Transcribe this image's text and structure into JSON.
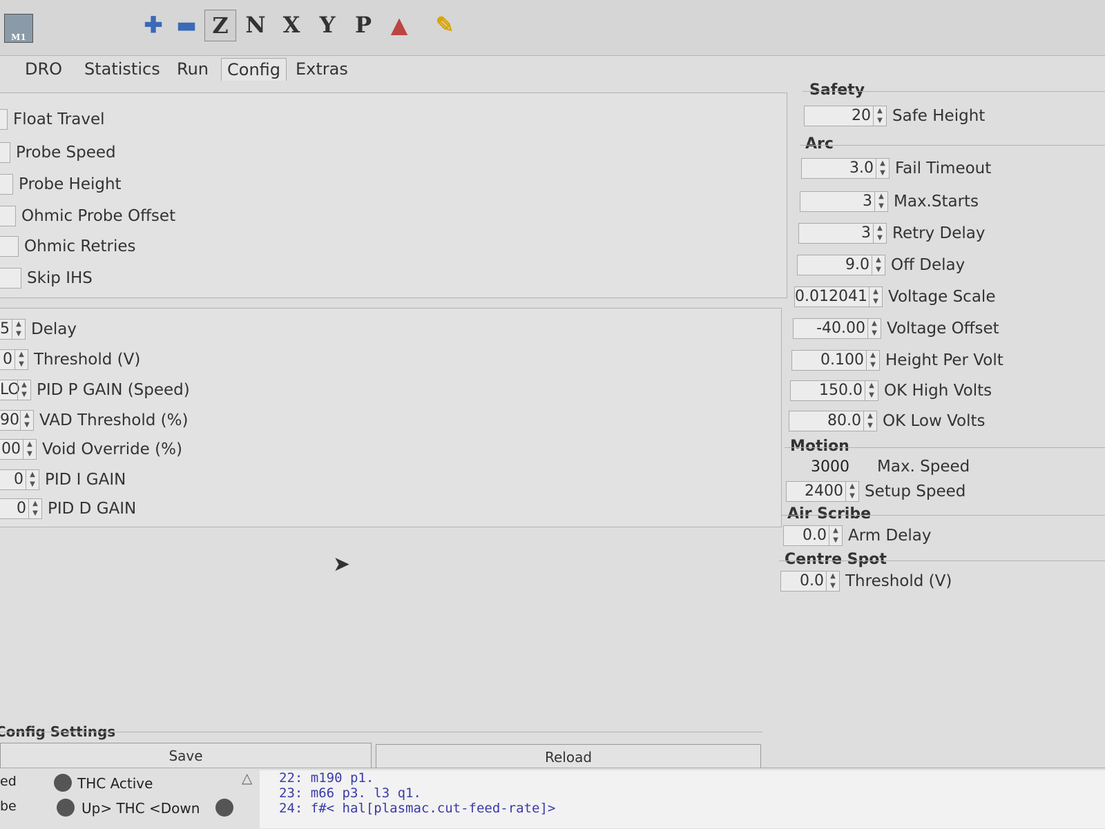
{
  "toolbar": {
    "buttons": [
      {
        "icon": "machine-icon"
      },
      {
        "icon": "plus-icon"
      },
      {
        "icon": "minus-icon"
      },
      {
        "label": "Z"
      },
      {
        "label": "N"
      },
      {
        "label": "X"
      },
      {
        "label": "Y"
      },
      {
        "label": "P"
      },
      {
        "icon": "torch-icon"
      },
      {
        "icon": "brush-icon"
      }
    ],
    "machine_text": "M1"
  },
  "tabs": [
    "DRO",
    "Statistics",
    "Run",
    "Config",
    "Extras"
  ],
  "active_tab": "Config",
  "left_panel_1": {
    "rows": [
      {
        "value": "",
        "label": "Float Travel"
      },
      {
        "value": "",
        "label": "Probe Speed"
      },
      {
        "value": "",
        "label": "Probe Height"
      },
      {
        "value": "",
        "label": "Ohmic Probe Offset"
      },
      {
        "value": "",
        "label": "Ohmic Retries"
      },
      {
        "value": "",
        "label": "Skip IHS"
      }
    ]
  },
  "left_panel_2": {
    "rows": [
      {
        "value": "5",
        "label": "Delay"
      },
      {
        "value": "0",
        "label": "Threshold (V)"
      },
      {
        "value": "LO",
        "label": "PID P GAIN (Speed)"
      },
      {
        "value": "90",
        "label": "VAD Threshold (%)"
      },
      {
        "value": "00",
        "label": "Void Override (%)"
      },
      {
        "value": "0",
        "label": "PID I GAIN"
      },
      {
        "value": "0",
        "label": "PID D GAIN"
      }
    ]
  },
  "safety": {
    "title": "Safety",
    "rows": [
      {
        "value": "20",
        "label": "Safe Height"
      }
    ]
  },
  "arc": {
    "title": "Arc",
    "rows": [
      {
        "value": "3.0",
        "label": "Fail Timeout"
      },
      {
        "value": "3",
        "label": "Max.Starts"
      },
      {
        "value": "3",
        "label": "Retry Delay"
      },
      {
        "value": "9.0",
        "label": "Off Delay"
      },
      {
        "value": "0.012041",
        "label": "Voltage Scale"
      },
      {
        "value": "-40.00",
        "label": "Voltage Offset"
      },
      {
        "value": "0.100",
        "label": "Height Per Volt"
      },
      {
        "value": "150.0",
        "label": "OK High Volts"
      },
      {
        "value": "80.0",
        "label": "OK Low Volts"
      }
    ]
  },
  "motion": {
    "title": "Motion",
    "max_speed_value": "3000",
    "max_speed_label": "Max. Speed",
    "setup_value": "2400",
    "setup_label": "Setup Speed"
  },
  "air_scribe": {
    "title": "Air Scribe",
    "value": "0.0",
    "label": "Arm Delay"
  },
  "centre_spot": {
    "title": "Centre Spot",
    "value": "0.0",
    "label": "Threshold (V)"
  },
  "config_settings": {
    "title": "Config Settings",
    "save": "Save",
    "reload": "Reload"
  },
  "status": {
    "left1": "ed",
    "left2": "be",
    "thc_active": "THC Active",
    "updown": "Up> THC <Down"
  },
  "gcode": [
    "22: m190 p1.",
    "23: m66 p3. l3 q1.",
    "24: f#< hal[plasmac.cut-feed-rate]>"
  ]
}
